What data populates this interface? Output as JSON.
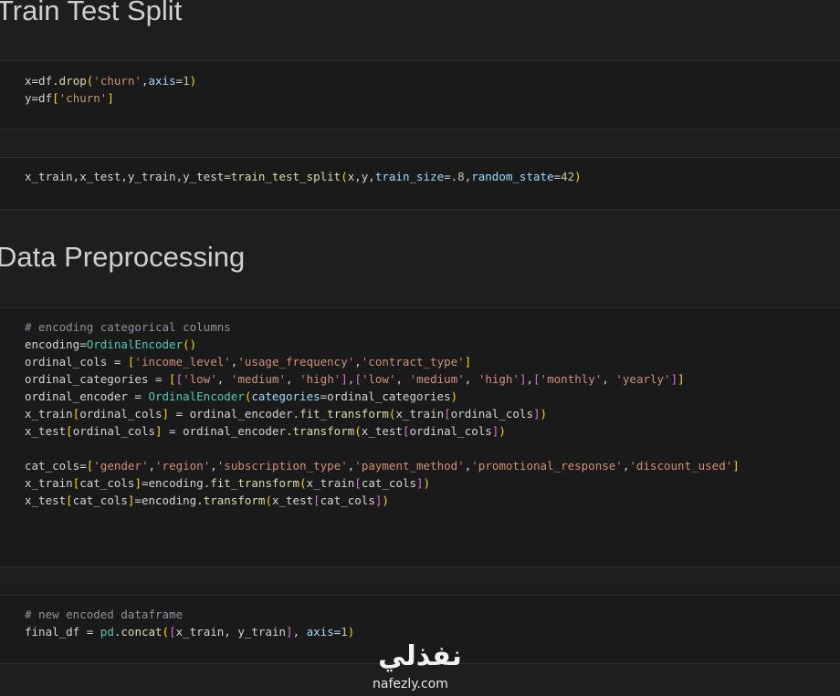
{
  "headings": {
    "train_test_split": "Train Test Split",
    "data_preprocessing": "Data Preprocessing"
  },
  "cells": [
    {
      "lines": [
        [
          [
            "var",
            "x=df."
          ],
          [
            "func",
            "drop"
          ],
          [
            "br1",
            "("
          ],
          [
            "str",
            "'churn'"
          ],
          [
            "var",
            ","
          ],
          [
            "kw",
            "axis"
          ],
          [
            "var",
            "="
          ],
          [
            "num",
            "1"
          ],
          [
            "br1",
            ")"
          ]
        ],
        [
          [
            "var",
            "y=df"
          ],
          [
            "br1",
            "["
          ],
          [
            "str",
            "'churn'"
          ],
          [
            "br1",
            "]"
          ]
        ]
      ]
    },
    {
      "lines": [
        [
          [
            "var",
            "x_train,x_test,y_train,y_test="
          ],
          [
            "func",
            "train_test_split"
          ],
          [
            "br1",
            "("
          ],
          [
            "var",
            "x,y,"
          ],
          [
            "kw",
            "train_size"
          ],
          [
            "var",
            "=."
          ],
          [
            "num",
            "8"
          ],
          [
            "var",
            ","
          ],
          [
            "kw",
            "random_state"
          ],
          [
            "var",
            "="
          ],
          [
            "num",
            "42"
          ],
          [
            "br1",
            ")"
          ]
        ]
      ]
    },
    {
      "lines": [
        [
          [
            "comment",
            "# encoding categorical columns"
          ]
        ],
        [
          [
            "var",
            "encoding="
          ],
          [
            "cls",
            "OrdinalEncoder"
          ],
          [
            "br1",
            "()"
          ]
        ],
        [
          [
            "var",
            "ordinal_cols = "
          ],
          [
            "br1",
            "["
          ],
          [
            "str",
            "'income_level'"
          ],
          [
            "var",
            ","
          ],
          [
            "str",
            "'usage_frequency'"
          ],
          [
            "var",
            ","
          ],
          [
            "str",
            "'contract_type'"
          ],
          [
            "br1",
            "]"
          ]
        ],
        [
          [
            "var",
            "ordinal_categories = "
          ],
          [
            "br1",
            "["
          ],
          [
            "br2",
            "["
          ],
          [
            "str",
            "'low'"
          ],
          [
            "var",
            ", "
          ],
          [
            "str",
            "'medium'"
          ],
          [
            "var",
            ", "
          ],
          [
            "str",
            "'high'"
          ],
          [
            "br2",
            "]"
          ],
          [
            "var",
            ","
          ],
          [
            "br2",
            "["
          ],
          [
            "str",
            "'low'"
          ],
          [
            "var",
            ", "
          ],
          [
            "str",
            "'medium'"
          ],
          [
            "var",
            ", "
          ],
          [
            "str",
            "'high'"
          ],
          [
            "br2",
            "]"
          ],
          [
            "var",
            ","
          ],
          [
            "br2",
            "["
          ],
          [
            "str",
            "'monthly'"
          ],
          [
            "var",
            ", "
          ],
          [
            "str",
            "'yearly'"
          ],
          [
            "br2",
            "]"
          ],
          [
            "br1",
            "]"
          ]
        ],
        [
          [
            "var",
            "ordinal_encoder = "
          ],
          [
            "cls",
            "OrdinalEncoder"
          ],
          [
            "br1",
            "("
          ],
          [
            "kw",
            "categories"
          ],
          [
            "var",
            "=ordinal_categories"
          ],
          [
            "br1",
            ")"
          ]
        ],
        [
          [
            "var",
            "x_train"
          ],
          [
            "br1",
            "["
          ],
          [
            "var",
            "ordinal_cols"
          ],
          [
            "br1",
            "]"
          ],
          [
            "var",
            " = ordinal_encoder."
          ],
          [
            "func",
            "fit_transform"
          ],
          [
            "br1",
            "("
          ],
          [
            "var",
            "x_train"
          ],
          [
            "br2",
            "["
          ],
          [
            "var",
            "ordinal_cols"
          ],
          [
            "br2",
            "]"
          ],
          [
            "br1",
            ")"
          ]
        ],
        [
          [
            "var",
            "x_test"
          ],
          [
            "br1",
            "["
          ],
          [
            "var",
            "ordinal_cols"
          ],
          [
            "br1",
            "]"
          ],
          [
            "var",
            " = ordinal_encoder."
          ],
          [
            "func",
            "transform"
          ],
          [
            "br1",
            "("
          ],
          [
            "var",
            "x_test"
          ],
          [
            "br2",
            "["
          ],
          [
            "var",
            "ordinal_cols"
          ],
          [
            "br2",
            "]"
          ],
          [
            "br1",
            ")"
          ]
        ],
        [],
        [
          [
            "var",
            "cat_cols="
          ],
          [
            "br1",
            "["
          ],
          [
            "str",
            "'gender'"
          ],
          [
            "var",
            ","
          ],
          [
            "str",
            "'region'"
          ],
          [
            "var",
            ","
          ],
          [
            "str",
            "'subscription_type'"
          ],
          [
            "var",
            ","
          ],
          [
            "str",
            "'payment_method'"
          ],
          [
            "var",
            ","
          ],
          [
            "str",
            "'promotional_response'"
          ],
          [
            "var",
            ","
          ],
          [
            "str",
            "'discount_used'"
          ],
          [
            "br1",
            "]"
          ]
        ],
        [
          [
            "var",
            "x_train"
          ],
          [
            "br1",
            "["
          ],
          [
            "var",
            "cat_cols"
          ],
          [
            "br1",
            "]"
          ],
          [
            "var",
            "=encoding."
          ],
          [
            "func",
            "fit_transform"
          ],
          [
            "br1",
            "("
          ],
          [
            "var",
            "x_train"
          ],
          [
            "br2",
            "["
          ],
          [
            "var",
            "cat_cols"
          ],
          [
            "br2",
            "]"
          ],
          [
            "br1",
            ")"
          ]
        ],
        [
          [
            "var",
            "x_test"
          ],
          [
            "br1",
            "["
          ],
          [
            "var",
            "cat_cols"
          ],
          [
            "br1",
            "]"
          ],
          [
            "var",
            "=encoding."
          ],
          [
            "func",
            "transform"
          ],
          [
            "br1",
            "("
          ],
          [
            "var",
            "x_test"
          ],
          [
            "br2",
            "["
          ],
          [
            "var",
            "cat_cols"
          ],
          [
            "br2",
            "]"
          ],
          [
            "br1",
            ")"
          ]
        ]
      ]
    },
    {
      "lines": [
        [
          [
            "comment",
            "# new encoded dataframe"
          ]
        ],
        [
          [
            "var",
            "final_df = "
          ],
          [
            "cls",
            "pd"
          ],
          [
            "var",
            "."
          ],
          [
            "func",
            "concat"
          ],
          [
            "br1",
            "("
          ],
          [
            "br2",
            "["
          ],
          [
            "var",
            "x_train, y_train"
          ],
          [
            "br2",
            "]"
          ],
          [
            "var",
            ", "
          ],
          [
            "kw",
            "axis"
          ],
          [
            "var",
            "="
          ],
          [
            "num",
            "1"
          ],
          [
            "br1",
            ")"
          ]
        ]
      ]
    }
  ],
  "watermark": {
    "arabic": "نفذلي",
    "latin": "nafezly.com"
  },
  "colors": {
    "background": "#1e1e1e",
    "cell_background": "#1a1a1a",
    "string": "#ce9178",
    "function": "#dcdcaa",
    "class": "#4ec9b0",
    "keyword_arg": "#9cdcfe",
    "number": "#b5cea8",
    "comment": "#8b949e",
    "bracket_level1": "#ffd700",
    "bracket_level2": "#da70d6"
  }
}
